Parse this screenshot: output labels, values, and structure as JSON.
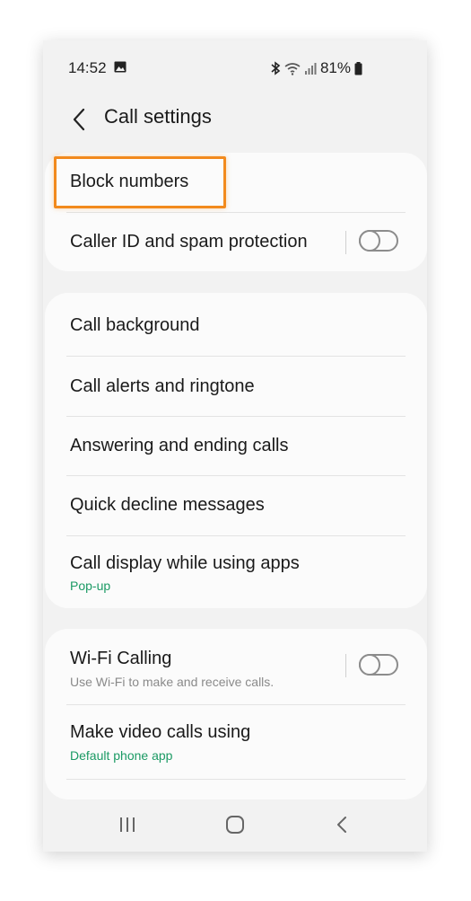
{
  "status_bar": {
    "time": "14:52",
    "battery": "81%",
    "icons": [
      "gallery-icon",
      "bluetooth-icon",
      "wifi-icon",
      "signal-icon",
      "battery-icon"
    ]
  },
  "header": {
    "title": "Call settings",
    "back_icon": "chevron-left-icon"
  },
  "sections": [
    {
      "items": [
        {
          "label": "Block numbers",
          "highlighted": true
        },
        {
          "label": "Caller ID and spam protection",
          "toggle": false
        }
      ]
    },
    {
      "items": [
        {
          "label": "Call background"
        },
        {
          "label": "Call alerts and ringtone"
        },
        {
          "label": "Answering and ending calls"
        },
        {
          "label": "Quick decline messages"
        },
        {
          "label": "Call display while using apps",
          "sub": "Pop-up"
        }
      ]
    },
    {
      "items": [
        {
          "label": "Wi-Fi Calling",
          "sub": "Use Wi-Fi to make and receive calls.",
          "toggle": false
        },
        {
          "label": "Make video calls using",
          "sub": "Default phone app"
        }
      ]
    }
  ],
  "nav_bar": {
    "icons": [
      "recent-apps-icon",
      "home-icon",
      "back-icon"
    ]
  },
  "colors": {
    "highlight": "#f28a1d",
    "accent_green": "#1b9a64",
    "background": "#f2f2f2",
    "card": "#fbfbfb"
  }
}
